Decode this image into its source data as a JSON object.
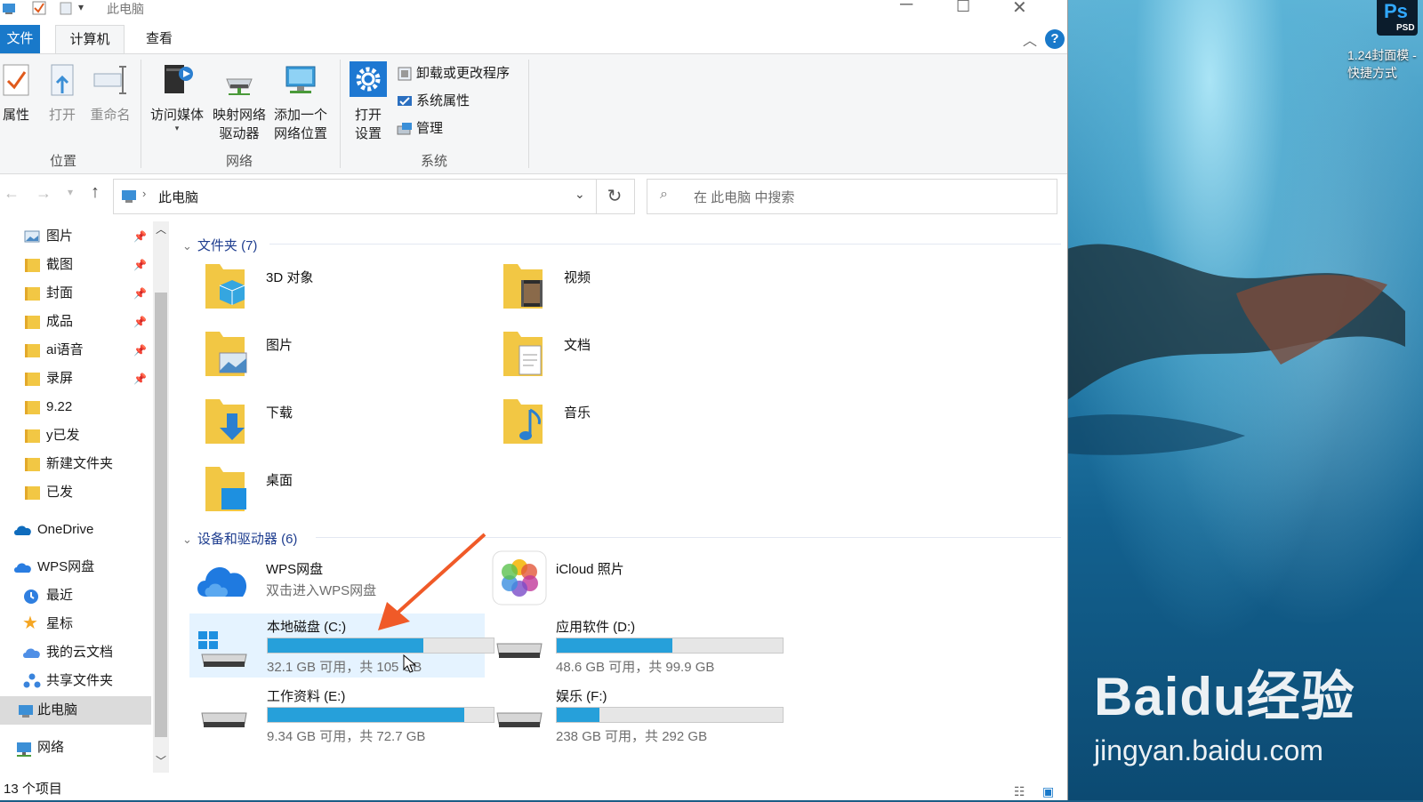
{
  "window": {
    "title": "此电脑"
  },
  "ribbon": {
    "tabs": [
      "文件",
      "计算机",
      "查看"
    ],
    "location_group": {
      "label": "位置",
      "buttons": [
        "属性",
        "打开",
        "重命名"
      ]
    },
    "network_group": {
      "label": "网络",
      "access_media": "访问媒体",
      "map_drive_1": "映射网络",
      "map_drive_2": "驱动器",
      "add_location_1": "添加一个",
      "add_location_2": "网络位置"
    },
    "system_group": {
      "label": "系统",
      "open_settings_1": "打开",
      "open_settings_2": "设置",
      "uninstall": "卸载或更改程序",
      "system_properties": "系统属性",
      "manage": "管理"
    }
  },
  "address": {
    "path": "此电脑",
    "search_placeholder": "在 此电脑 中搜索"
  },
  "sidebar": {
    "quick_access": [
      {
        "label": "图片",
        "pinned": true
      },
      {
        "label": "截图",
        "pinned": true
      },
      {
        "label": "封面",
        "pinned": true
      },
      {
        "label": "成品",
        "pinned": true
      },
      {
        "label": "ai语音",
        "pinned": true
      },
      {
        "label": "录屏",
        "pinned": true
      },
      {
        "label": "9.22",
        "pinned": false
      },
      {
        "label": "y已发",
        "pinned": false
      },
      {
        "label": "新建文件夹",
        "pinned": false
      },
      {
        "label": "已发",
        "pinned": false
      }
    ],
    "onedrive": "OneDrive",
    "wps": "WPS网盘",
    "wps_children": [
      "最近",
      "星标",
      "我的云文档",
      "共享文件夹"
    ],
    "this_pc": "此电脑",
    "network": "网络"
  },
  "folders_section": {
    "title": "文件夹 (7)",
    "items": [
      "3D 对象",
      "视频",
      "图片",
      "文档",
      "下载",
      "音乐",
      "桌面"
    ]
  },
  "devices_section": {
    "title": "设备和驱动器 (6)",
    "wps": {
      "name": "WPS网盘",
      "sub": "双击进入WPS网盘"
    },
    "icloud": {
      "name": "iCloud 照片"
    },
    "drives": [
      {
        "name": "本地磁盘 (C:)",
        "info": "32.1 GB 可用，共 105 GB",
        "used_fraction": 0.69
      },
      {
        "name": "应用软件 (D:)",
        "info": "48.6 GB 可用，共 99.9 GB",
        "used_fraction": 0.51
      },
      {
        "name": "工作资料 (E:)",
        "info": "9.34 GB 可用，共 72.7 GB",
        "used_fraction": 0.87
      },
      {
        "name": "娱乐 (F:)",
        "info": "238 GB 可用，共 292 GB",
        "used_fraction": 0.19
      }
    ]
  },
  "status": {
    "count": "13 个项目"
  },
  "desktop": {
    "ps_badge": "Ps",
    "psd_badge": "PSD",
    "shortcut_label": "1.24封面模 - 快捷方式",
    "watermark_main": "Baidu经验",
    "watermark_sub": "jingyan.baidu.com"
  },
  "colors": {
    "accent": "#1979ca",
    "drive_fill": "#26a0da",
    "annotation_arrow": "#f05a28"
  }
}
